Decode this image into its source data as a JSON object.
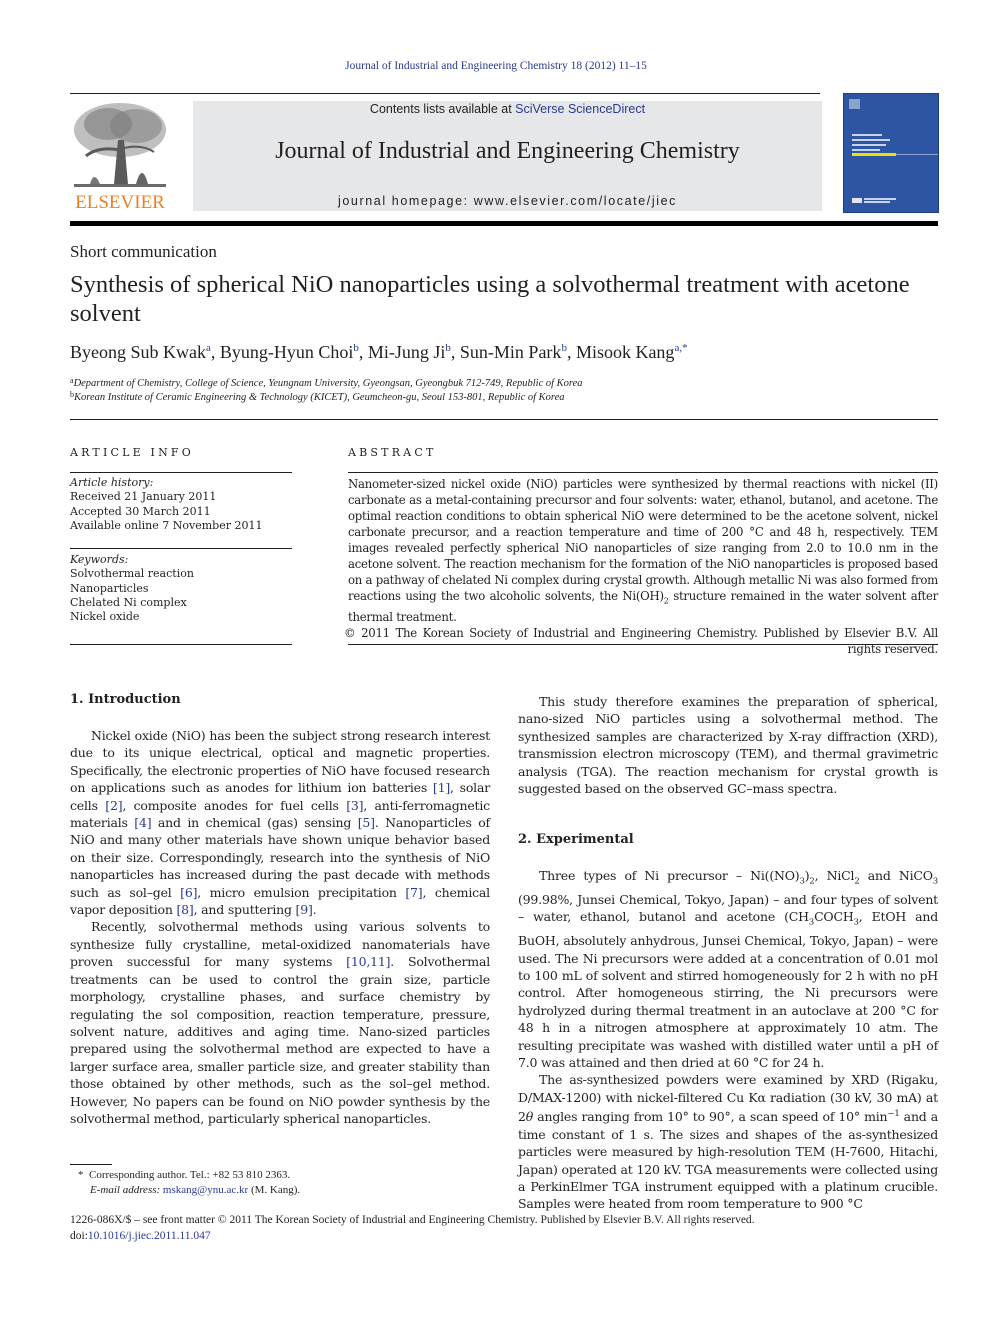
{
  "running_header": "Journal of Industrial and Engineering Chemistry 18 (2012) 11–15",
  "masthead": {
    "contents_prefix": "Contents lists available at ",
    "contents_link": "SciVerse ScienceDirect",
    "journal_title": "Journal of Industrial and Engineering Chemistry",
    "homepage": "journal homepage: www.elsevier.com/locate/jiec",
    "publisher_logo_text": "ELSEVIER",
    "publisher_logo_icon": "tree-icon",
    "cover_icon": "journal-cover-icon",
    "colors": {
      "publisher_orange": "#f07e23",
      "link_blue": "#2b3a8f",
      "banner_gray": "#e6e7e8",
      "cover_blue": "#2d55a4"
    }
  },
  "article": {
    "type": "Short communication",
    "title": "Synthesis of spherical NiO nanoparticles using a solvothermal treatment with acetone solvent",
    "authors": [
      {
        "name": "Byeong Sub Kwak",
        "sup": "a"
      },
      {
        "name": "Byung-Hyun Choi",
        "sup": "b"
      },
      {
        "name": "Mi-Jung Ji",
        "sup": "b"
      },
      {
        "name": "Sun-Min Park",
        "sup": "b"
      },
      {
        "name": "Misook Kang",
        "sup": "a,*"
      }
    ],
    "affiliations": [
      {
        "key": "a",
        "text": "Department of Chemistry, College of Science, Yeungnam University, Gyeongsan, Gyeongbuk 712-749, Republic of Korea"
      },
      {
        "key": "b",
        "text": "Korean Institute of Ceramic Engineering & Technology (KICET), Geumcheon-gu, Seoul 153-801, Republic of Korea"
      }
    ]
  },
  "article_info": {
    "heading": "ARTICLE INFO",
    "history_label": "Article history:",
    "history": [
      "Received 21 January 2011",
      "Accepted 30 March 2011",
      "Available online 7 November 2011"
    ],
    "keywords_label": "Keywords:",
    "keywords": [
      "Solvothermal reaction",
      "Nanoparticles",
      "Chelated Ni complex",
      "Nickel oxide"
    ]
  },
  "abstract": {
    "heading": "ABSTRACT",
    "text_1": "Nanometer-sized nickel oxide (NiO) particles were synthesized by thermal reactions with nickel (II) carbonate as a metal-containing precursor and four solvents: water, ethanol, butanol, and acetone. The optimal reaction conditions to obtain spherical NiO were determined to be the acetone solvent, nickel carbonate precursor, and a reaction temperature and time of 200 °C and 48 h, respectively. TEM images revealed perfectly spherical NiO nanoparticles of size ranging from 2.0 to 10.0 nm in the acetone solvent. The reaction mechanism for the formation of the NiO nanoparticles is proposed based on a pathway of chelated Ni complex during crystal growth. Although metallic Ni was also formed from reactions using the two alcoholic solvents, the Ni(OH)",
    "sub_2": "2",
    "text_2": " structure remained in the water solvent after thermal treatment.",
    "copyright": "© 2011 The Korean Society of Industrial and Engineering Chemistry. Published by Elsevier B.V. All rights reserved."
  },
  "intro": {
    "heading": "1.  Introduction",
    "p1": [
      "Nickel oxide (NiO) has been the subject strong research interest due to its unique electrical, optical and magnetic properties. Specifically, the electronic properties of NiO have focused research on applications such as anodes for lithium ion batteries ",
      "[1]",
      ", solar cells ",
      "[2]",
      ", composite anodes for fuel cells ",
      "[3]",
      ", anti-ferromagnetic materials ",
      "[4]",
      " and in chemical (gas) sensing ",
      "[5]",
      ". Nanoparticles of NiO and many other materials have shown unique behavior based on their size. Correspondingly, research into the synthesis of NiO nanoparticles has increased during the past decade with methods such as sol–gel ",
      "[6]",
      ", micro emulsion precipitation ",
      "[7]",
      ", chemical vapor deposition ",
      "[8]",
      ", and sputtering ",
      "[9]",
      "."
    ],
    "p2": [
      "Recently, solvothermal methods using various solvents to synthesize fully crystalline, metal-oxidized nanomaterials have proven successful for many systems ",
      "[10,11]",
      ". Solvothermal treatments can be used to control the grain size, particle morphology, crystalline phases, and surface chemistry by regulating the sol composition, reaction temperature, pressure, solvent nature, additives and aging time. Nano-sized particles prepared using the solvothermal method are expected to have a larger surface area, smaller particle size, and greater stability than those obtained by other methods, such as the sol–gel method. However, No papers can be found on NiO powder synthesis by the solvothermal method, particularly spherical nanoparticles."
    ],
    "p3": "This study therefore examines the preparation of spherical, nano-sized NiO particles using a solvothermal method. The synthesized samples are characterized by X-ray diffraction (XRD), transmission electron microscopy (TEM), and thermal gravimetric analysis (TGA). The reaction mechanism for crystal growth is suggested based on the observed GC–mass spectra."
  },
  "experimental": {
    "heading": "2.  Experimental",
    "p1": [
      "Three types of Ni precursor – Ni((NO)",
      "3",
      ")",
      "2",
      ", NiCl",
      "2",
      " and NiCO",
      "3",
      " (99.98%, Junsei Chemical, Tokyo, Japan) – and four types of solvent – water, ethanol, butanol and acetone (CH",
      "3",
      "COCH",
      "3",
      ", EtOH and BuOH, absolutely anhydrous, Junsei Chemical, Tokyo, Japan) – were used. The Ni precursors were added at a concentration of 0.01 mol to 100 mL of solvent and stirred homogeneously for 2 h with no pH control. After homogeneous stirring, the Ni precursors were hydrolyzed during thermal treatment in an autoclave at 200 °C for 48 h in a nitrogen atmosphere at approximately 10 atm. The resulting precipitate was washed with distilled water until a pH of 7.0 was attained and then dried at 60 °C for 24 h."
    ],
    "p2": [
      "The as-synthesized powders were examined by XRD (Rigaku, D/MAX-1200) with nickel-filtered Cu Kα radiation (30 kV, 30 mA) at 2",
      "θ",
      " angles ranging from 10° to 90°, a scan speed of 10° min",
      "−1",
      " and a time constant of 1 s. The sizes and shapes of the as-synthesized particles were measured by high-resolution TEM (H-7600, Hitachi, Japan) operated at 120 kV. TGA measurements were collected using a PerkinElmer TGA instrument equipped with a platinum crucible. Samples were heated from room temperature to 900 °C"
    ]
  },
  "footnote": {
    "marker": "*",
    "corresponding": "Corresponding author. Tel.: +82 53 810 2363.",
    "email_label": "E-mail address: ",
    "email": "mskang@ynu.ac.kr",
    "email_suffix": " (M. Kang)."
  },
  "bottom": {
    "issn_line": "1226-086X/$ – see front matter © 2011 The Korean Society of Industrial and Engineering Chemistry. Published by Elsevier B.V. All rights reserved.",
    "doi_prefix": "doi:",
    "doi": "10.1016/j.jiec.2011.11.047"
  }
}
